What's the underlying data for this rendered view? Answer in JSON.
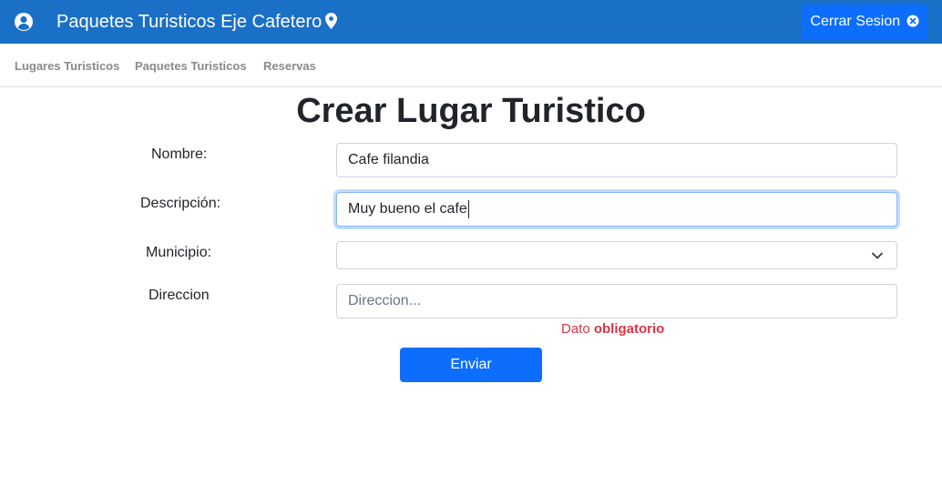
{
  "header": {
    "brand": "Paquetes Turisticos Eje Cafetero",
    "logout_label": "Cerrar Sesion",
    "color": "#1a6fc7",
    "icons": [
      "user-circle-icon",
      "map-pin-icon",
      "close-circle-icon"
    ]
  },
  "nav": {
    "items": [
      {
        "label": "Lugares Turisticos"
      },
      {
        "label": "Paquetes Turisticos"
      },
      {
        "label": "Reservas"
      }
    ]
  },
  "form": {
    "title": "Crear Lugar Turistico",
    "nombre": {
      "label": "Nombre:",
      "value": "Cafe filandia"
    },
    "descripcion": {
      "label": "Descripción:",
      "value": "Muy bueno el cafe"
    },
    "municipio": {
      "label": "Municipio:",
      "value": ""
    },
    "direccion": {
      "label": "Direccion",
      "placeholder": "Direccion..."
    },
    "error": {
      "prefix": "Dato",
      "strong": "obligatorio",
      "color": "#dc3545"
    },
    "submit_label": "Enviar",
    "accent": "#0d6efd"
  }
}
